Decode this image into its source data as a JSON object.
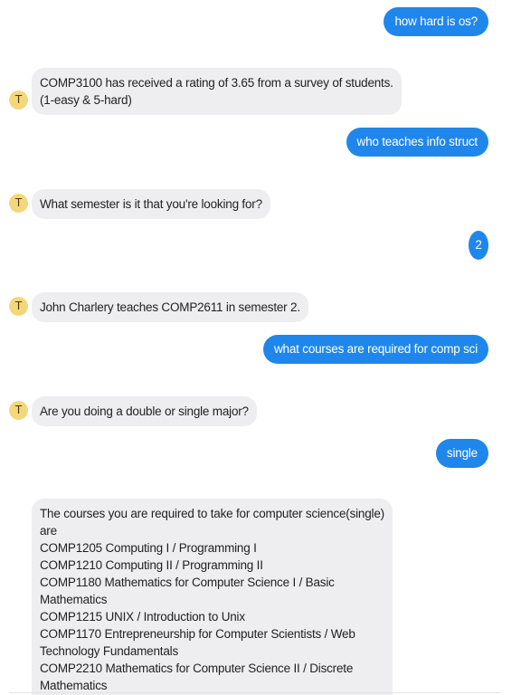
{
  "bot": {
    "avatar_letter": "T"
  },
  "conversation": {
    "user_1": "how hard is os?",
    "bot_1": [
      "COMP3100 has received a rating of 3.65 from a survey of students.",
      "(1-easy & 5-hard)"
    ],
    "user_2": "who teaches info struct",
    "bot_2": [
      "What semester is it that you're looking for?"
    ],
    "user_3": "2",
    "bot_3": [
      "John Charlery teaches COMP2611 in semester 2."
    ],
    "user_4": "what courses are required for comp sci",
    "bot_4": [
      "Are you doing a double or single major?"
    ],
    "user_5": "single",
    "bot_5": [
      "The courses you are required to take for computer science(single)",
      "are",
      "COMP1205 Computing I / Programming I",
      "COMP1210 Computing II / Programming II",
      "COMP1180 Mathematics for Computer Science I / Basic",
      "Mathematics",
      "COMP1215 UNIX / Introduction to Unix",
      "COMP1170 Entrepreneurship for Computer Scientists / Web",
      "Technology  Fundamentals",
      "COMP2210 Mathematics for Computer Science II / Discrete",
      "Mathematics"
    ]
  }
}
